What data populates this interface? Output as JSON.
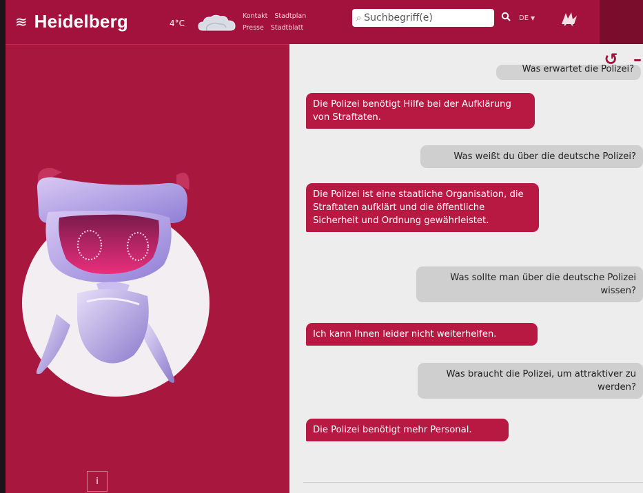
{
  "header": {
    "logo_text": "Heidelberg",
    "temperature": "4°C",
    "weather_icon": "cloud-icon",
    "links": [
      "Kontakt",
      "Stadtplan",
      "Presse",
      "Stadtblatt"
    ],
    "search_placeholder": "Suchbegriff(e)",
    "language": "DE",
    "colors": {
      "brand": "#a3123d",
      "accent": "#b81943"
    }
  },
  "chat": {
    "partial_message": "Was erwartet die Polizei?",
    "messages": [
      {
        "role": "bot",
        "text": "Die Polizei benötigt Hilfe bei der Aufklärung von Straftaten."
      },
      {
        "role": "user",
        "text": "Was weißt du über die deutsche Polizei?"
      },
      {
        "role": "bot",
        "text": "Die Polizei ist eine staatliche Organisation, die Straftaten aufklärt und die öffentliche Sicherheit und Ordnung gewährleistet."
      },
      {
        "role": "user",
        "text": "Was sollte man über die deutsche Polizei wissen?"
      },
      {
        "role": "bot",
        "text": "Ich kann Ihnen leider nicht weiterhelfen."
      },
      {
        "role": "user",
        "text": "Was braucht die Polizei, um attraktiver zu werden?"
      },
      {
        "role": "bot",
        "text": "Die Polizei benötigt mehr Personal."
      }
    ],
    "tools": {
      "reset_icon": "↺",
      "minimize_icon": "–"
    }
  },
  "left": {
    "info_label": "i"
  }
}
